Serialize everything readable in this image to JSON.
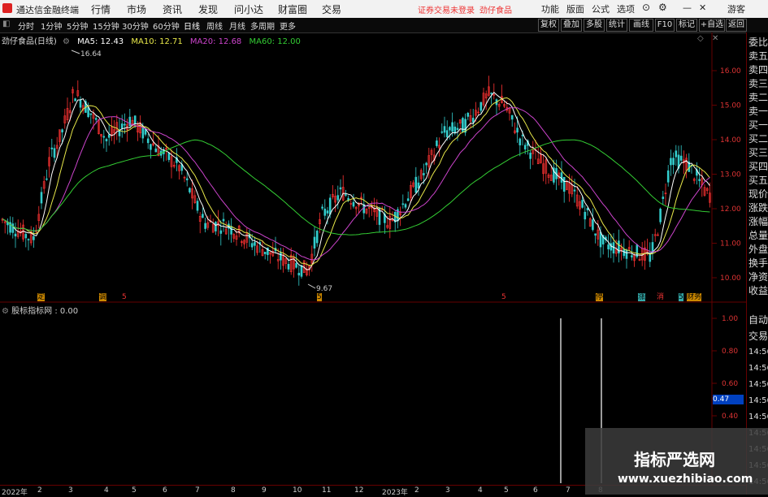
{
  "app": {
    "name": "通达信金融终端",
    "menu": [
      "行情",
      "市场",
      "资讯",
      "发现",
      "问小达",
      "财富圈",
      "交易"
    ],
    "notice": "证券交易未登录",
    "stock_link": "劲仔食品",
    "right_menu": [
      "功能",
      "版面",
      "公式",
      "选项",
      "游客"
    ]
  },
  "toolbar": {
    "periods": [
      "分时",
      "1分钟",
      "5分钟",
      "15分钟",
      "30分钟",
      "60分钟",
      "日线",
      "周线",
      "月线",
      "多周期",
      "更多"
    ],
    "active": "日线",
    "right_buttons": [
      "复权",
      "叠加",
      "多股",
      "统计",
      "画线",
      "F10",
      "标记",
      "+自选",
      "返回"
    ]
  },
  "chart": {
    "stock_title": "劲仔食品(日线)",
    "ma5": "MA5: 12.43",
    "ma10": "MA10: 12.71",
    "ma20": "MA20: 12.68",
    "ma60": "MA60: 12.00",
    "high_label": "16.64",
    "low_label": "9.67",
    "price_ticks": [
      "16.00",
      "15.00",
      "14.00",
      "13.00",
      "12.00",
      "11.00",
      "10.00"
    ]
  },
  "indicator": {
    "title": "股标指标网 : 0.00",
    "ticks": [
      "1.00",
      "0.80",
      "0.60",
      "0.47",
      "0.40"
    ],
    "current": "0.47"
  },
  "right_panel": [
    "委比",
    "卖五",
    "卖四",
    "卖三",
    "卖二",
    "卖一",
    "买一",
    "买二",
    "买三",
    "买四",
    "买五",
    "现价",
    "涨跌",
    "涨幅",
    "总量",
    "外盘",
    "换手",
    "净资",
    "收益"
  ],
  "right_panel_bottom": [
    "自动",
    "交易",
    "14:56",
    "14:56",
    "14:56",
    "14:56",
    "14:56",
    "14:56",
    "14:56",
    "14:56",
    "14:56"
  ],
  "badges": [
    "定",
    "调",
    "5",
    "5",
    "5",
    "停",
    "涨",
    "消",
    "5",
    "财务"
  ],
  "xaxis": [
    "2022年",
    "2",
    "3",
    "4",
    "5",
    "6",
    "7",
    "8",
    "9",
    "10",
    "11",
    "12",
    "2023年",
    "2",
    "3",
    "4",
    "5",
    "6",
    "7",
    "8"
  ],
  "watermark": {
    "line1": "指标严选网",
    "line2": "www.xuezhibiao.com"
  },
  "colors": {
    "up": "#ff3333",
    "down": "#33cccc",
    "ma5": "#ffffff",
    "ma10": "#e8e84a",
    "ma20": "#cc44cc",
    "ma60": "#33cc33"
  }
}
